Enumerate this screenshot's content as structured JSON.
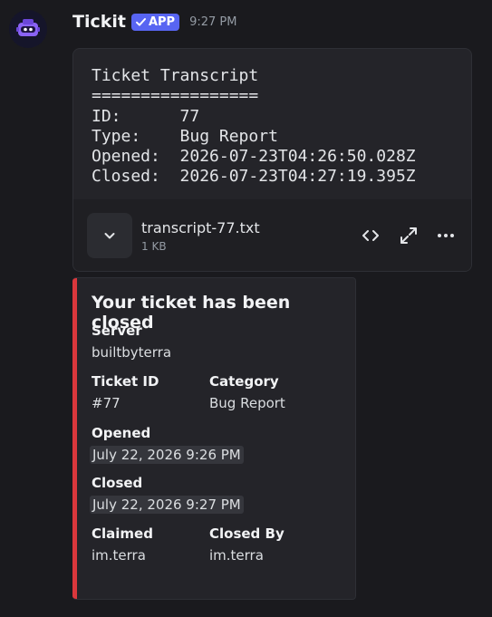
{
  "message": {
    "author": "Tickit",
    "badge": "APP",
    "timestamp": "9:27 PM",
    "avatar_icon": "robot-mascot-icon"
  },
  "attachment": {
    "preview_lines": [
      "Ticket Transcript",
      "=================",
      "ID:      77",
      "Type:    Bug Report",
      "Opened:  2026-07-23T04:26:50.028Z",
      "Closed:  2026-07-23T04:27:19.395Z"
    ],
    "file_name": "transcript-77.txt",
    "file_size": "1 KB",
    "icons": [
      "chevron-down-icon",
      "code-icon",
      "expand-icon",
      "more-icon"
    ]
  },
  "embed": {
    "accent_color": "#da373c",
    "title": "Your ticket has been closed",
    "server": {
      "name": "Server",
      "value": "builtbyterra"
    },
    "ticket_id": {
      "name": "Ticket ID",
      "value": "#77"
    },
    "category": {
      "name": "Category",
      "value": "Bug Report"
    },
    "opened": {
      "name": "Opened",
      "value": "July 22, 2026 9:26 PM"
    },
    "closed": {
      "name": "Closed",
      "value": "July 22, 2026 9:27 PM"
    },
    "claimed": {
      "name": "Claimed",
      "value": "im.terra"
    },
    "closed_by": {
      "name": "Closed By",
      "value": "im.terra"
    }
  }
}
